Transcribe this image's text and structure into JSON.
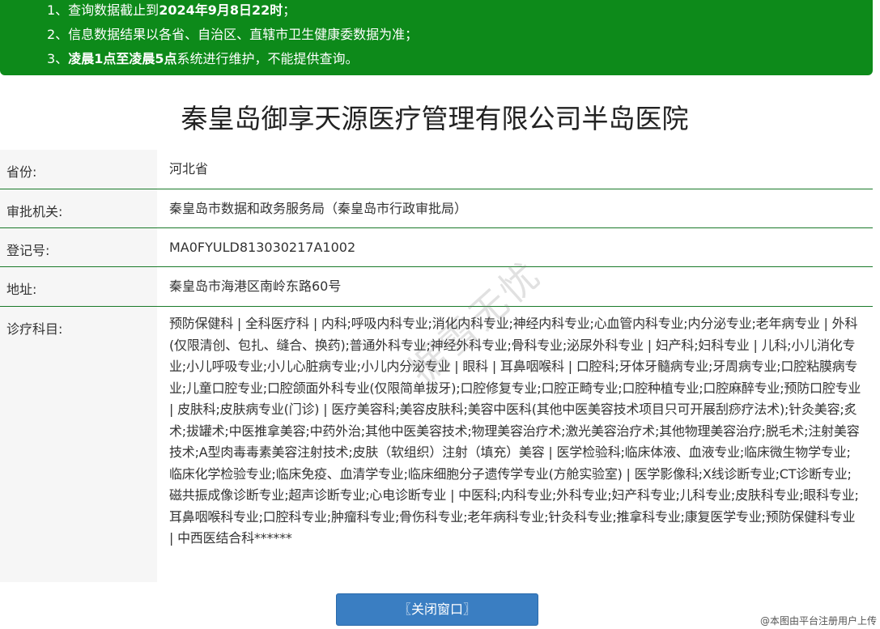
{
  "notice": {
    "line1_prefix": "1、查询数据截止到",
    "line1_bold": "2024年9月8日22时",
    "line1_suffix": "；",
    "line2": "2、信息数据结果以各省、自治区、直辖市卫生健康委数据为准；",
    "line3_prefix": "3、",
    "line3_bold": "凌晨1点至凌晨5点",
    "line3_suffix": "系统进行维护，不能提供查询。"
  },
  "title": "秦皇岛御享天源医疗管理有限公司半岛医院",
  "info": {
    "province_label": "省份:",
    "province_value": "河北省",
    "authority_label": "审批机关:",
    "authority_value": "秦皇岛市数据和政务服务局（秦皇岛市行政审批局）",
    "regno_label": "登记号:",
    "regno_value": "MA0FYULD813030217A1002",
    "address_label": "地址:",
    "address_value": "秦皇岛市海港区南岭东路60号",
    "departments_label": "诊疗科目:",
    "departments_value": "预防保健科 | 全科医疗科 | 内科;呼吸内科专业;消化内科专业;神经内科专业;心血管内科专业;内分泌专业;老年病专业 | 外科(仅限清创、包扎、缝合、换药);普通外科专业;神经外科专业;骨科专业;泌尿外科专业 | 妇产科;妇科专业 | 儿科;小儿消化专业;小儿呼吸专业;小儿心脏病专业;小儿内分泌专业 | 眼科 | 耳鼻咽喉科 | 口腔科;牙体牙髓病专业;牙周病专业;口腔粘膜病专业;儿童口腔专业;口腔颌面外科专业(仅限简单拔牙);口腔修复专业;口腔正畸专业;口腔种植专业;口腔麻醉专业;预防口腔专业 | 皮肤科;皮肤病专业(门诊) | 医疗美容科;美容皮肤科;美容中医科(其他中医美容技术项目只可开展刮痧疗法术);针灸美容;炙术;拔罐术;中医推拿美容;中药外治;其他中医美容技术;物理美容治疗术;激光美容治疗术;其他物理美容治疗;脱毛术;注射美容技术;A型肉毒毒素美容注射技术;皮肤（软组织）注射（填充）美容 | 医学检验科;临床体液、血液专业;临床微生物学专业;临床化学检验专业;临床免疫、血清学专业;临床细胞分子遗传学专业(方舱实验室) | 医学影像科;X线诊断专业;CT诊断专业;磁共振成像诊断专业;超声诊断专业;心电诊断专业 | 中医科;内科专业;外科专业;妇产科专业;儿科专业;皮肤科专业;眼科专业;耳鼻咽喉科专业;口腔科专业;肿瘤科专业;骨伤科专业;老年病科专业;针灸科专业;推拿科专业;康复医学专业;预防保健科专业 | 中西医结合科******"
  },
  "close_button": "〖关闭窗口〗",
  "watermark_diag": "据雪无忧",
  "watermark_corner": "@本图由平台注册用户上传"
}
